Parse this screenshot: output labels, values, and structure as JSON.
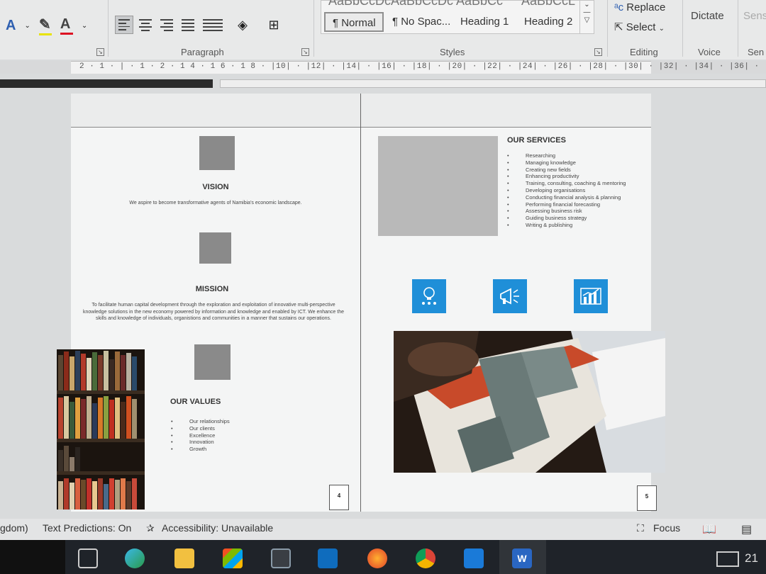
{
  "ribbon": {
    "font_group_label": "",
    "paragraph_label": "Paragraph",
    "styles_label": "Styles",
    "editing_label": "Editing",
    "voice_label": "Voice",
    "sens_label": "Sen",
    "styles": [
      "¶ Normal",
      "¶ No Spac...",
      "Heading 1",
      "Heading 2"
    ],
    "style_previews": [
      "AaBbCcDc",
      "AaBbCcDc",
      "AaBbCc",
      "AaBbCcL"
    ],
    "replace_label": "Replace",
    "select_label": "Select",
    "dictate_label": "Dictate",
    "sens_top": "Sens"
  },
  "ruler": {
    "numbers": "2 · 1 · | · 1 · 2 · 1 4 · 1 6 · 1 8 · |10| · |12| · |14| · |16| · |18| · |20| · |22| · |24| · |26| · |28| · |30| · |32| · |34| · |36| · |38|"
  },
  "page4": {
    "vision_heading": "VISION",
    "vision_text": "We aspire to become transformative agents of Namibia's economic landscape.",
    "mission_heading": "MISSION",
    "mission_text": "To facilitate human capital development through the exploration and exploitation of innovative multi-perspective knowledge solutions in the new economy powered by information and knowledge and enabled by ICT. We enhance the skills and knowledge of individuals, organistions and communities in a manner that sustains our operations.",
    "values_heading": "OUR VALUES",
    "values": [
      "Our relationships",
      "Our clients",
      "Excellence",
      "Innovation",
      "Growth"
    ],
    "page_number": "4"
  },
  "page5": {
    "services_heading": "OUR SERVICES",
    "services": [
      "Researching",
      "Managing knowledge",
      "Creating new fields",
      "Enhancing productivity",
      "Training, consulting, coaching & mentoring",
      "Developing organisations",
      "Conducting financial analysis & planning",
      "Performing financial forecasting",
      "Assessing business risk",
      "Guiding business strategy",
      "Writing & publishing"
    ],
    "page_number": "5"
  },
  "status": {
    "language": "gdom)",
    "text_predictions": "Text Predictions: On",
    "accessibility": "Accessibility: Unavailable",
    "focus": "Focus"
  },
  "taskbar": {
    "clock": "21"
  },
  "colors": {
    "accent_blue": "#1f8fd8",
    "word_blue": "#185abd"
  }
}
